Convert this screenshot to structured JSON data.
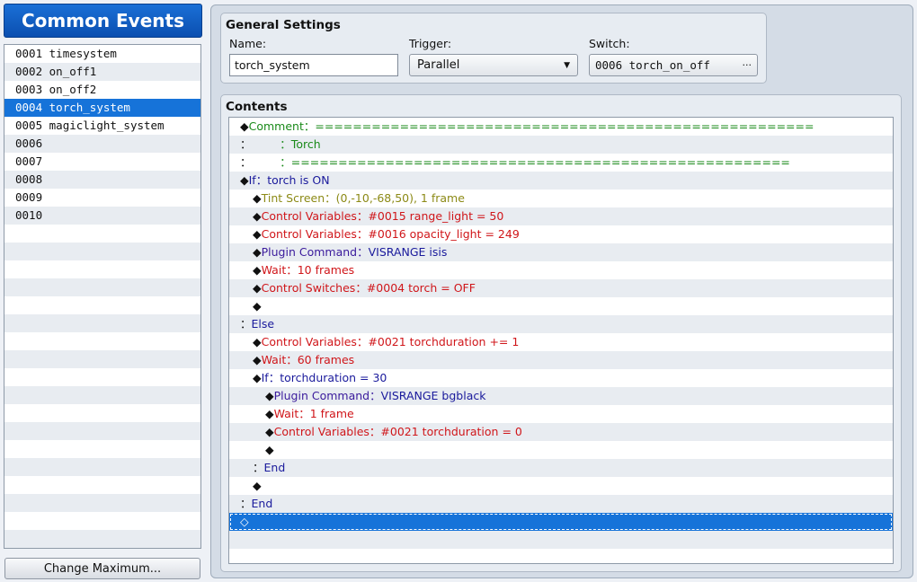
{
  "window": {
    "title": "Common Events"
  },
  "event_list": [
    {
      "id": "0001",
      "name": "timesystem"
    },
    {
      "id": "0002",
      "name": "on_off1"
    },
    {
      "id": "0003",
      "name": "on_off2"
    },
    {
      "id": "0004",
      "name": "torch_system",
      "selected": true
    },
    {
      "id": "0005",
      "name": "magiclight_system"
    },
    {
      "id": "0006",
      "name": ""
    },
    {
      "id": "0007",
      "name": ""
    },
    {
      "id": "0008",
      "name": ""
    },
    {
      "id": "0009",
      "name": ""
    },
    {
      "id": "0010",
      "name": ""
    }
  ],
  "change_max_label": "Change Maximum...",
  "general": {
    "title": "General Settings",
    "name_label": "Name:",
    "name_value": "torch_system",
    "trigger_label": "Trigger:",
    "trigger_value": "Parallel",
    "switch_label": "Switch:",
    "switch_value": "0006 torch_on_off",
    "switch_button": "···"
  },
  "contents": {
    "title": "Contents",
    "lines": [
      {
        "indent": 0,
        "marker": "◆",
        "parts": [
          {
            "t": "Comment：",
            "c": "comment"
          },
          {
            "t": "=====================================================",
            "c": "comment"
          }
        ]
      },
      {
        "indent": 0,
        "marker": "：",
        "parts": [
          {
            "t": "        ：Torch",
            "c": "comment"
          }
        ]
      },
      {
        "indent": 0,
        "marker": "：",
        "parts": [
          {
            "t": "        ：=====================================================",
            "c": "comment"
          }
        ]
      },
      {
        "indent": 0,
        "marker": "◆",
        "parts": [
          {
            "t": "If：torch is ON",
            "c": "blue"
          }
        ]
      },
      {
        "indent": 1,
        "marker": "◆",
        "parts": [
          {
            "t": "Tint Screen：(0,-10,-68,50), 1 frame",
            "c": "olive"
          }
        ]
      },
      {
        "indent": 1,
        "marker": "◆",
        "parts": [
          {
            "t": "Control Variables：#0015 range_light = 50",
            "c": "red"
          }
        ]
      },
      {
        "indent": 1,
        "marker": "◆",
        "parts": [
          {
            "t": "Control Variables：#0016 opacity_light = 249",
            "c": "red"
          }
        ]
      },
      {
        "indent": 1,
        "marker": "◆",
        "parts": [
          {
            "t": "Plugin Command：",
            "c": "purple"
          },
          {
            "t": "VISRANGE isis",
            "c": "blue"
          }
        ]
      },
      {
        "indent": 1,
        "marker": "◆",
        "parts": [
          {
            "t": "Wait：10 frames",
            "c": "red"
          }
        ]
      },
      {
        "indent": 1,
        "marker": "◆",
        "parts": [
          {
            "t": "Control Switches：#0004 torch = OFF",
            "c": "red"
          }
        ]
      },
      {
        "indent": 1,
        "marker": "◆",
        "parts": []
      },
      {
        "indent": 0,
        "marker": "：",
        "parts": [
          {
            "t": "Else",
            "c": "blue"
          }
        ]
      },
      {
        "indent": 1,
        "marker": "◆",
        "parts": [
          {
            "t": "Control Variables：#0021 torchduration += 1",
            "c": "red"
          }
        ]
      },
      {
        "indent": 1,
        "marker": "◆",
        "parts": [
          {
            "t": "Wait：60 frames",
            "c": "red"
          }
        ]
      },
      {
        "indent": 1,
        "marker": "◆",
        "parts": [
          {
            "t": "If：torchduration = 30",
            "c": "blue"
          }
        ]
      },
      {
        "indent": 2,
        "marker": "◆",
        "parts": [
          {
            "t": "Plugin Command：",
            "c": "purple"
          },
          {
            "t": "VISRANGE bgblack",
            "c": "blue"
          }
        ]
      },
      {
        "indent": 2,
        "marker": "◆",
        "parts": [
          {
            "t": "Wait：1 frame",
            "c": "red"
          }
        ]
      },
      {
        "indent": 2,
        "marker": "◆",
        "parts": [
          {
            "t": "Control Variables：#0021 torchduration = 0",
            "c": "red"
          }
        ]
      },
      {
        "indent": 2,
        "marker": "◆",
        "parts": []
      },
      {
        "indent": 1,
        "marker": "：",
        "parts": [
          {
            "t": "End",
            "c": "blue"
          }
        ]
      },
      {
        "indent": 1,
        "marker": "◆",
        "parts": []
      },
      {
        "indent": 0,
        "marker": "：",
        "parts": [
          {
            "t": "End",
            "c": "blue"
          }
        ]
      },
      {
        "indent": 0,
        "marker": "◆",
        "parts": [],
        "selected": true
      }
    ]
  },
  "colors": {
    "selection": "#1673d9",
    "comment": "#1a8a1a",
    "command_red": "#d0161a",
    "flow_blue": "#1a1a9c",
    "tint_olive": "#8c8a16"
  }
}
